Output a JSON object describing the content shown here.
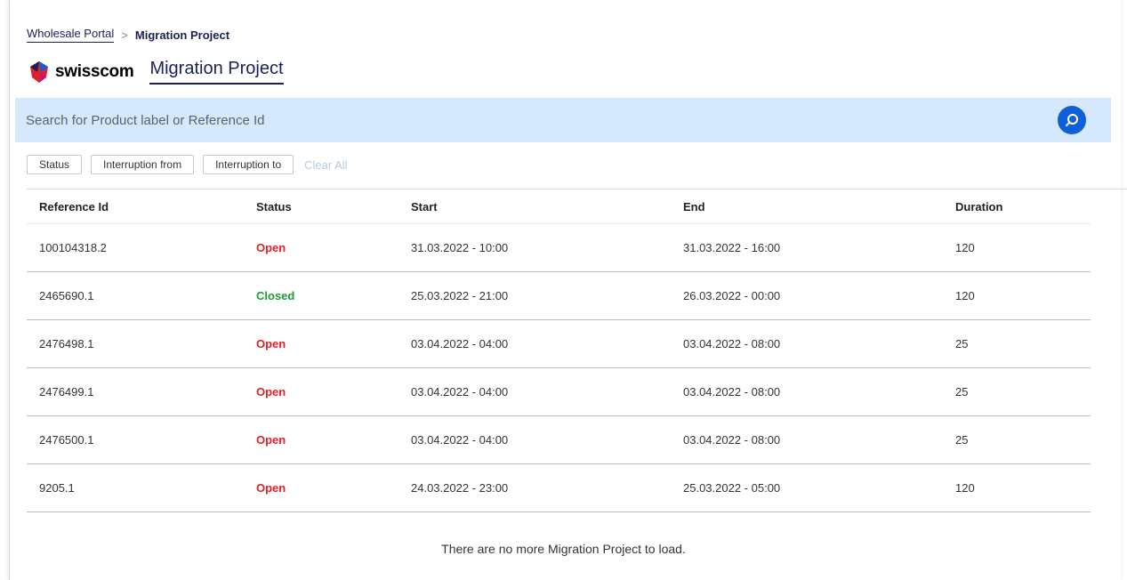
{
  "breadcrumb": {
    "root": "Wholesale Portal",
    "separator": ">",
    "current": "Migration Project"
  },
  "brand": {
    "logo_text": "swisscom",
    "page_title": "Migration Project"
  },
  "search": {
    "placeholder": "Search for Product label or Reference Id",
    "icon": "search-icon"
  },
  "filters": {
    "status": "Status",
    "interruption_from": "Interruption from",
    "interruption_to": "Interruption to",
    "clear_all": "Clear All"
  },
  "table": {
    "headers": [
      "Reference Id",
      "Status",
      "Start",
      "End",
      "Duration"
    ],
    "rows": [
      {
        "ref": "100104318.2",
        "status": "Open",
        "start": "31.03.2022 - 10:00",
        "end": "31.03.2022 - 16:00",
        "duration": "120"
      },
      {
        "ref": "2465690.1",
        "status": "Closed",
        "start": "25.03.2022 - 21:00",
        "end": "26.03.2022 - 00:00",
        "duration": "120"
      },
      {
        "ref": "2476498.1",
        "status": "Open",
        "start": "03.04.2022 - 04:00",
        "end": "03.04.2022 - 08:00",
        "duration": "25"
      },
      {
        "ref": "2476499.1",
        "status": "Open",
        "start": "03.04.2022 - 04:00",
        "end": "03.04.2022 - 08:00",
        "duration": "25"
      },
      {
        "ref": "2476500.1",
        "status": "Open",
        "start": "03.04.2022 - 04:00",
        "end": "03.04.2022 - 08:00",
        "duration": "25"
      },
      {
        "ref": "9205.1",
        "status": "Open",
        "start": "24.03.2022 - 23:00",
        "end": "25.03.2022 - 05:00",
        "duration": "120"
      }
    ]
  },
  "footer": {
    "message": "There are no more Migration Project to load."
  },
  "colors": {
    "status_open": "#e0202a",
    "status_closed": "#1f9b38",
    "search_bg": "#d6e8fb",
    "accent": "#0e5fd8",
    "brand_navy": "#1b1f5a"
  }
}
